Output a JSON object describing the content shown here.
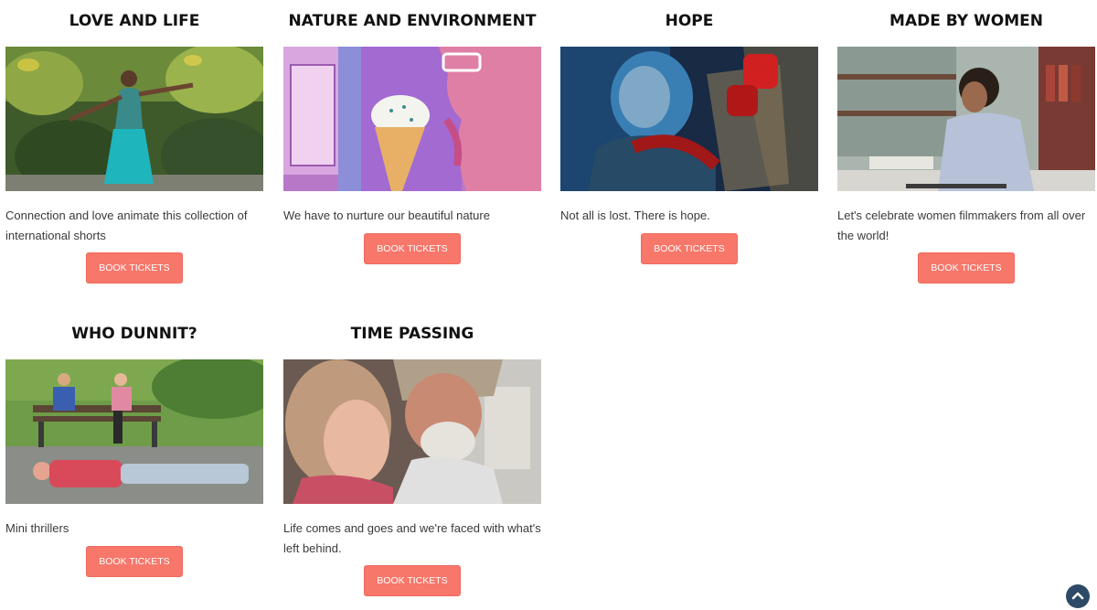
{
  "book_label": "BOOK TICKETS",
  "accent_color": "#f7776a",
  "cards": [
    {
      "title": "LOVE AND LIFE",
      "description": "Connection and love animate this collection of international shorts",
      "image_icon": "dancer-in-garden-image"
    },
    {
      "title": "NATURE AND ENVIRONMENT",
      "description": "We have to nurture our beautiful nature",
      "image_icon": "ice-cream-illustration-image"
    },
    {
      "title": "HOPE",
      "description": "Not all is lost. There is hope.",
      "image_icon": "old-woman-blue-light-image"
    },
    {
      "title": "MADE BY WOMEN",
      "description": "Let's celebrate women filmmakers from all over the world!",
      "image_icon": "woman-writing-library-image"
    },
    {
      "title": "WHO DUNNIT?",
      "description": "Mini thrillers",
      "image_icon": "park-bench-body-image"
    },
    {
      "title": "TIME PASSING",
      "description": "Life comes and goes and we're faced with what's left behind.",
      "image_icon": "girl-and-grandfather-image"
    }
  ],
  "scroll_top_icon": "chevron-up-icon"
}
